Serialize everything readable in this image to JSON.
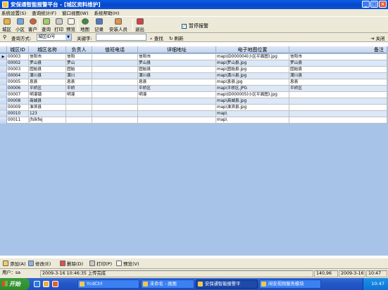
{
  "window": {
    "title": "安保通智能报警平台 - [城区资料维护]"
  },
  "menu": [
    "系统设置(S)",
    "查询统计(F)",
    "窗口视图(W)",
    "系统帮助(H)"
  ],
  "toolbar": {
    "buttons": [
      "城区",
      "小区",
      "客户",
      "查询",
      "打印",
      "预览",
      "地图",
      "记录",
      "安装人员",
      "退出"
    ],
    "pause_label": "暂停报警",
    "pause_checked": true
  },
  "search": {
    "query_mode_label": "查询方式:",
    "query_mode_value": "城区ID号",
    "keyword_label": "关键字:",
    "keyword_value": "",
    "find_label": "查找",
    "refresh_label": "刷新",
    "close_label": "关闭"
  },
  "grid": {
    "columns": [
      "城区ID",
      "城区名称",
      "负责人",
      "值班电话",
      "详细地址",
      "电子地图位置",
      "备注"
    ],
    "rows": [
      [
        "00003",
        "信阳市",
        "信阳",
        "",
        "信阳市",
        "map\\ID000004(小区平面图).jpg",
        "信阳市"
      ],
      [
        "00002",
        "罗山县",
        "罗山",
        "",
        "罗山县",
        "map\\罗山县.jpg",
        "罗山县"
      ],
      [
        "00003",
        "固始县",
        "固始",
        "",
        "固始县",
        "map\\固始县.jpg",
        "固始县"
      ],
      [
        "00004",
        "潢川县",
        "潢川",
        "",
        "潢川县",
        "map\\潢川县.jpg",
        "潢川县"
      ],
      [
        "00005",
        "息县",
        "息县",
        "",
        "息县",
        "map\\息县.jpg",
        "息县"
      ],
      [
        "00006",
        "平桥区",
        "平桥",
        "",
        "平桥区",
        "map\\平桥区.JPG",
        "平桥区"
      ],
      [
        "00007",
        "明港镇",
        "明港",
        "",
        "明港",
        "map\\ID000005(小区平面图).jpg",
        ""
      ],
      [
        "00008",
        "商城县",
        "",
        "",
        "",
        "map\\商城县.jpg",
        ""
      ],
      [
        "00009",
        "淮滨县",
        "",
        "",
        "",
        "map\\淮滨县.jpg",
        ""
      ],
      [
        "00010",
        "123",
        "",
        "",
        "",
        "map\\",
        ""
      ],
      [
        "00011",
        "jfslkfej",
        "",
        "",
        "",
        "map\\",
        ""
      ]
    ]
  },
  "actions": [
    "添加(A)",
    "修改(E)",
    "删除(D)",
    "打印(P)",
    "预览(V)"
  ],
  "status": {
    "user": "用户：sa",
    "message": "2009-3-16 10:46:35 上传完成",
    "coords": "140,96",
    "date": "2009-3-16",
    "time": "10:47"
  },
  "taskbar": {
    "start_label": "开始",
    "tasks": [
      "YcdCtrl",
      "未命名 - 画图",
      "安保通智能报警平",
      "闲安视频服务模块"
    ],
    "clock": "10:47"
  }
}
